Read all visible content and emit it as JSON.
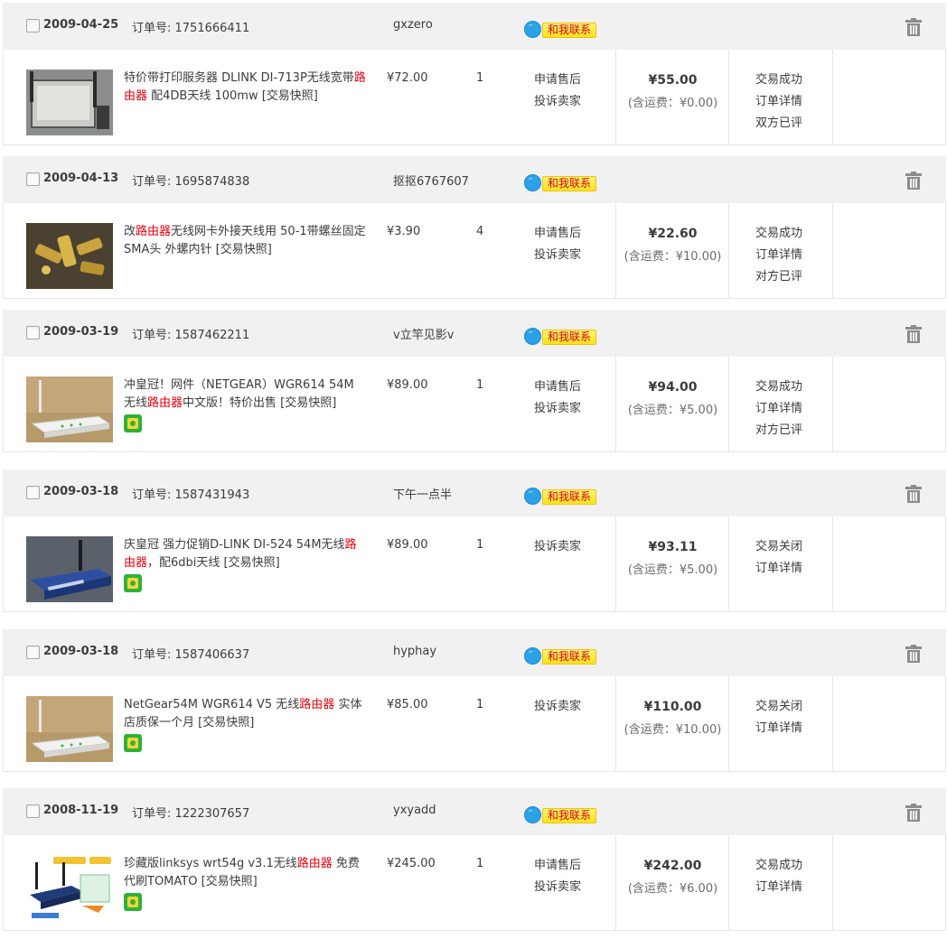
{
  "labels": {
    "order_no": "订单号:",
    "contact": "和我联系",
    "snapshot": "[交易快照]"
  },
  "colors": {
    "highlight": "#e4000d",
    "header_bg": "#f1f1f1",
    "contact_text": "#d2061b"
  },
  "orders": [
    {
      "date": "2009-04-25",
      "order_no": "1751666411",
      "seller": "gxzero",
      "title_pre": "特价带打印服务器 DLINK DI-713P无线宽带",
      "title_hl": "路由器",
      "title_post": " 配4DB天线 100mw ",
      "price": "¥72.00",
      "qty": "1",
      "svc": [
        "申请售后",
        "投诉卖家"
      ],
      "total": "¥55.00",
      "ship": "(含运费：¥0.00)",
      "status": [
        "交易成功",
        "订单详情",
        "双方已评"
      ],
      "badge": false,
      "thumb": "router-dlink-713p"
    },
    {
      "date": "2009-04-13",
      "order_no": "1695874838",
      "seller": "抠抠6767607",
      "title_pre": "改",
      "title_hl": "路由器",
      "title_post": "无线网卡外接天线用 50-1带螺丝固定SMA头 外螺内针 ",
      "price": "¥3.90",
      "qty": "4",
      "svc": [
        "申请售后",
        "投诉卖家"
      ],
      "total": "¥22.60",
      "ship": "(含运费：¥10.00)",
      "status": [
        "交易成功",
        "订单详情",
        "对方已评"
      ],
      "badge": false,
      "thumb": "sma-connectors"
    },
    {
      "date": "2009-03-19",
      "order_no": "1587462211",
      "seller": "v立竿见影v",
      "title_pre": "冲皇冠！网件（NETGEAR）WGR614 54M 无线",
      "title_hl": "路由器",
      "title_post": "中文版！特价出售 ",
      "price": "¥89.00",
      "qty": "1",
      "svc": [
        "申请售后",
        "投诉卖家"
      ],
      "total": "¥94.00",
      "ship": "(含运费：¥5.00)",
      "status": [
        "交易成功",
        "订单详情",
        "对方已评"
      ],
      "badge": true,
      "thumb": "router-netgear-white"
    },
    {
      "date": "2009-03-18",
      "order_no": "1587431943",
      "seller": "下午一点半",
      "title_pre": "庆皇冠 强力促销D-LINK DI-524 54M无线",
      "title_hl": "路由器",
      "title_post": "，配6dbi天线 ",
      "price": "¥89.00",
      "qty": "1",
      "svc": [
        "投诉卖家"
      ],
      "total": "¥93.11",
      "ship": "(含运费：¥5.00)",
      "status": [
        "交易关闭",
        "订单详情"
      ],
      "badge": true,
      "thumb": "router-dlink-524"
    },
    {
      "date": "2009-03-18",
      "order_no": "1587406637",
      "seller": "hyphay",
      "title_pre": "NetGear54M WGR614 V5 无线",
      "title_hl": "路由器",
      "title_post": " 实体店质保一个月 ",
      "price": "¥85.00",
      "qty": "1",
      "svc": [
        "投诉卖家"
      ],
      "total": "¥110.00",
      "ship": "(含运费：¥10.00)",
      "status": [
        "交易关闭",
        "订单详情"
      ],
      "badge": true,
      "thumb": "router-netgear-white"
    },
    {
      "date": "2008-11-19",
      "order_no": "1222307657",
      "seller": "yxyadd",
      "title_pre": "珍藏版linksys wrt54g v3.1无线",
      "title_hl": "路由器",
      "title_post": " 免费代刷TOMATO ",
      "price": "¥245.00",
      "qty": "1",
      "svc": [
        "申请售后",
        "投诉卖家"
      ],
      "total": "¥242.00",
      "ship": "(含运费：¥6.00)",
      "status": [
        "交易成功",
        "订单详情"
      ],
      "badge": true,
      "thumb": "router-linksys-wrt54g"
    }
  ]
}
